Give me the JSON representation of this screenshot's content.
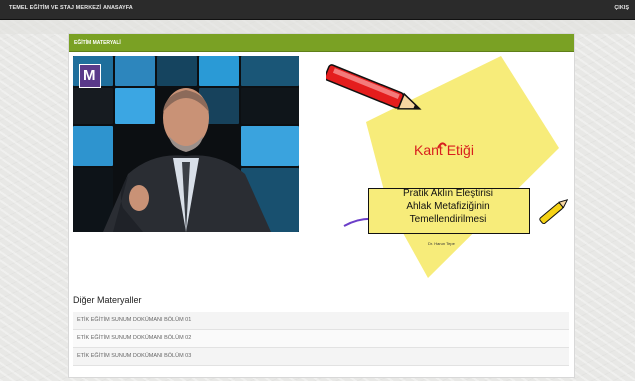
{
  "topbar": {
    "brand": "TEMEL EĞİTİM VE STAJ MERKEZİ",
    "home": "ANASAYFA",
    "logout": "ÇIKIŞ"
  },
  "panel": {
    "title": "EĞİTİM MATERYALİ"
  },
  "video": {
    "logo_text": "M"
  },
  "slide": {
    "title": "Kant Etiği",
    "subtitle_lines": [
      "Pratik Aklın Eleştirisi",
      "Ahlak Metafiziğinin",
      "Temellendirilmesi"
    ],
    "author": "Dr. Harun Tepe"
  },
  "materials": {
    "heading": "Diğer Materyaller",
    "items": [
      "ETİK EĞİTİM SUNUM DOKÜMANI BÖLÜM 01",
      "ETİK EĞİTİM SUNUM DOKÜMANI BÖLÜM 02",
      "ETİK EĞİTİM SUNUM DOKÜMANI BÖLÜM 03"
    ]
  },
  "colors": {
    "topbar": "#2b2b2b",
    "panel_header": "#7aa124",
    "slide_yellow": "#f7ec7a",
    "slide_red": "#d81e1e"
  }
}
